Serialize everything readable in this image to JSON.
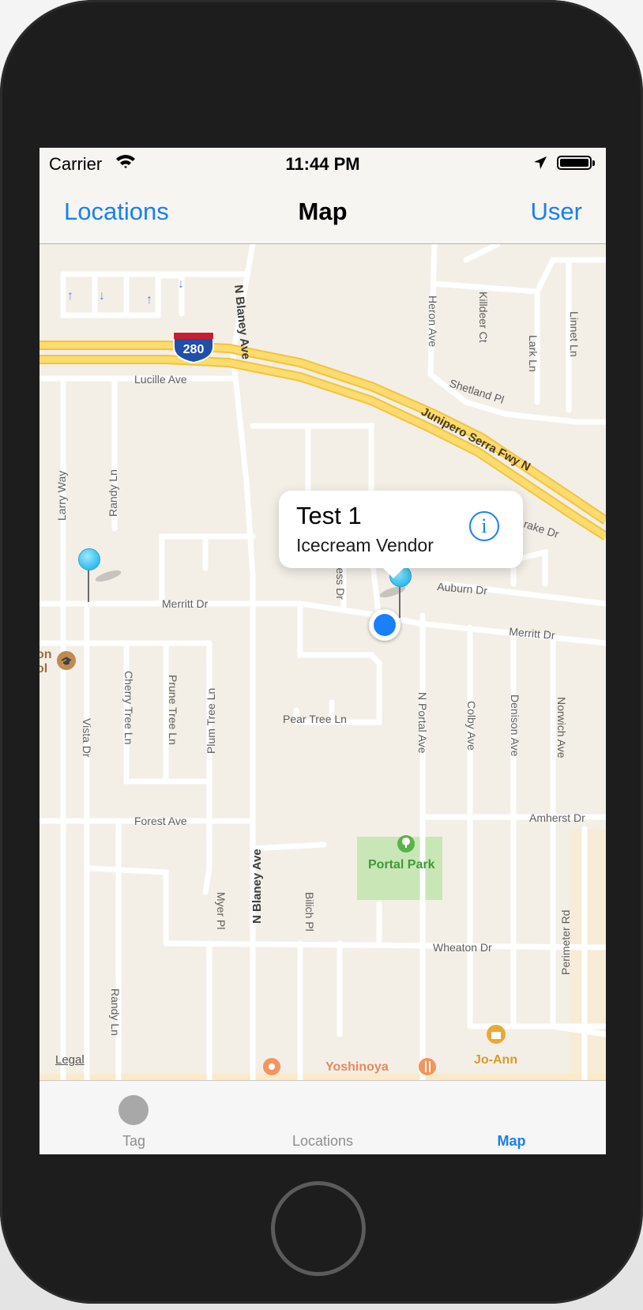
{
  "status_bar": {
    "carrier": "Carrier",
    "time": "11:44 PM",
    "icons": [
      "wifi-icon",
      "location-arrow-icon",
      "battery-icon"
    ]
  },
  "nav_bar": {
    "left_button": "Locations",
    "title": "Map",
    "right_button": "User"
  },
  "map": {
    "streets": {
      "n_blaney_ave": "N Blaney Ave",
      "lucille_ave": "Lucille Ave",
      "junipero_serra": "Junipero Serra Fwy N",
      "heron_ave": "Heron Ave",
      "killdeer_ct": "Killdeer Ct",
      "lark_ln": "Lark Ln",
      "linnet_ln": "Linnet Ln",
      "shetland_pl": "Shetland Pl",
      "larry_way": "Larry Way",
      "randy_ln": "Randy Ln",
      "merritt_dr": "Merritt Dr",
      "cypress_dr": "ypress Dr",
      "drake_dr": "rake Dr",
      "auburn_dr": "Auburn Dr",
      "cherry_tree_ln": "Cherry Tree Ln",
      "prune_tree_ln": "Prune Tree Ln",
      "plum_tree_ln": "Plum Tree Ln",
      "vista_dr": "Vista Dr",
      "pear_tree_ln": "Pear Tree Ln",
      "n_portal_ave": "N Portal Ave",
      "colby_ave": "Colby Ave",
      "denison_ave": "Denison Ave",
      "norwich_ave": "Norwich Ave",
      "forest_ave": "Forest Ave",
      "amherst_dr": "Amherst Dr",
      "myer_pl": "Myer Pl",
      "bilich_pl": "Bilich Pl",
      "wheaton_dr": "Wheaton Dr",
      "perimeter_rd": "Perimeter Rd"
    },
    "shield": "280",
    "pois": {
      "school_partial": [
        "on",
        "ol"
      ],
      "portal_park": "Portal Park",
      "yoshinoya": "Yoshinoya",
      "jo_ann": "Jo-Ann"
    },
    "legal": "Legal",
    "callout": {
      "title": "Test 1",
      "subtitle": "Icecream Vendor",
      "info_glyph": "i"
    },
    "colors": {
      "land": "#f3efe7",
      "road": "#ffffff",
      "highway": "#f9d24f",
      "park": "#c8e6b6",
      "pin": "#3fc3ee",
      "user_location": "#197ffb",
      "accent": "#1a7ff0"
    }
  },
  "tab_bar": {
    "tabs": [
      {
        "label": "Tag",
        "icon": "circle-icon",
        "active": false
      },
      {
        "label": "Locations",
        "icon": "",
        "active": false
      },
      {
        "label": "Map",
        "icon": "",
        "active": true
      }
    ]
  }
}
